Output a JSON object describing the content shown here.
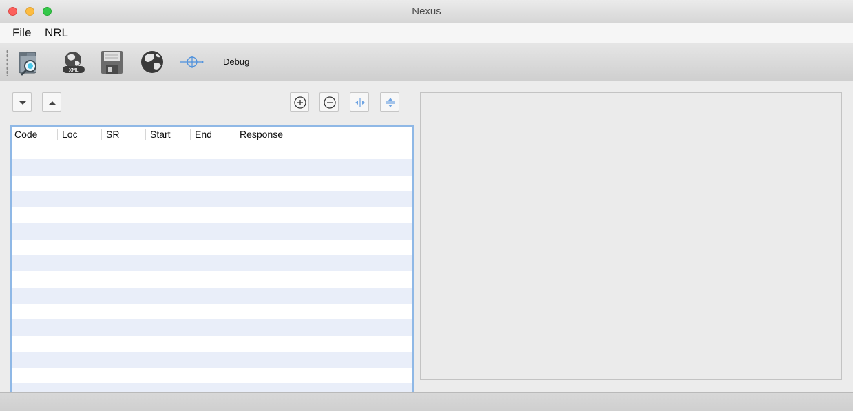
{
  "window": {
    "title": "Nexus"
  },
  "menu": {
    "items": [
      "File",
      "NRL"
    ]
  },
  "toolbar": {
    "icons": [
      "open-folder-icon",
      "xml-globe-icon",
      "save-disk-icon",
      "globe-icon",
      "crosshair-icon"
    ],
    "debug_label": "Debug"
  },
  "list_controls": {
    "icons": [
      "chevron-down-icon",
      "chevron-up-icon"
    ]
  },
  "zoom_controls": {
    "icons": [
      "zoom-in-icon",
      "zoom-out-icon",
      "expand-horizontal-icon",
      "expand-vertical-icon"
    ]
  },
  "table": {
    "columns": [
      "Code",
      "Loc",
      "SR",
      "Start",
      "End",
      "Response"
    ],
    "rows": []
  },
  "colors": {
    "accent": "#8fb8e6",
    "row_alt": "#e9eef9",
    "close": "#fc605c",
    "minimize": "#fdbc40",
    "maximize": "#34c84a"
  }
}
